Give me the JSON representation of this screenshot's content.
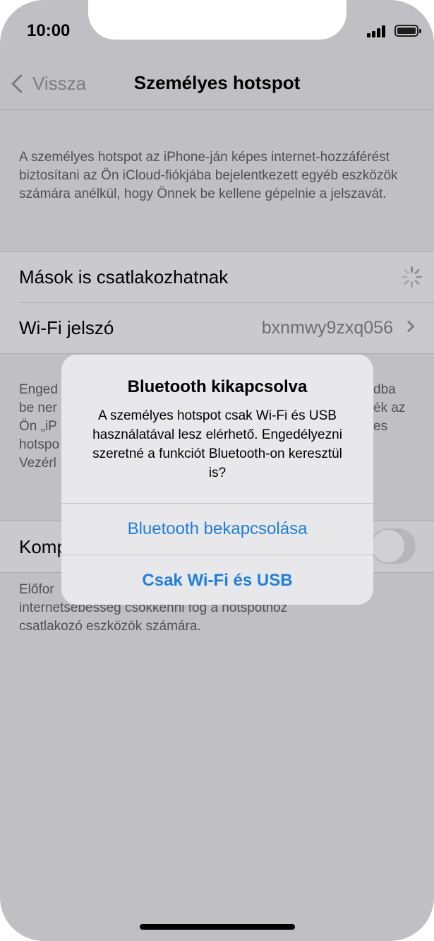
{
  "status_bar": {
    "time": "10:00"
  },
  "nav": {
    "back_label": "Vissza",
    "title": "Személyes hotspot"
  },
  "intro_description": "A személyes hotspot az iPhone-ján képes internet-hozzáférést biztosítani az Ön iCloud-fiókjába bejelentkezett egyéb eszközök számára anélkül, hogy Önnek be kellene gépelnie a jelszavát.",
  "settings": {
    "allow_others_label": "Mások is csatlakozhatnak",
    "wifi_password_label": "Wi-Fi jelszó",
    "wifi_password_value": "bxnmwy9zxq056"
  },
  "partial_text": {
    "allow_description_lines": [
      "Enged",
      "be ner",
      "Ön „iP",
      "hotspo",
      "Vezérl"
    ],
    "allow_description_right": [
      "dba",
      "ék az",
      "es"
    ],
    "compat_label_partial": "Komp",
    "compat_description_partial": "Előfor",
    "compat_description_lines": [
      "internetsebesség csökkenni fog a hotspothoz",
      "csatlakozó eszközök számára."
    ]
  },
  "alert": {
    "title": "Bluetooth kikapcsolva",
    "message": "A személyes hotspot csak Wi-Fi és USB használatával lesz elérhető. Engedélyezni szeretné a funkciót Bluetooth-on keresztül is?",
    "primary_button": "Bluetooth bekapcsolása",
    "secondary_button": "Csak Wi-Fi és USB"
  },
  "colors": {
    "accent": "#1e7fdc",
    "dimmed_background": "#c0c0c4",
    "alert_background": "#e8e8ea"
  },
  "icons": [
    "back-chevron-icon",
    "signal-icon",
    "battery-icon",
    "spinner-icon",
    "chevron-right-icon"
  ]
}
